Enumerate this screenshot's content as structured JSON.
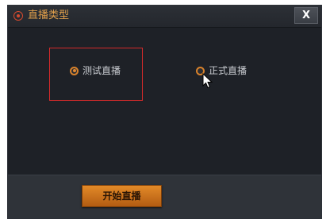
{
  "window": {
    "title": "直播类型",
    "close_label": "X",
    "accent_color": "#e2a04b",
    "icon": "record-icon"
  },
  "options": [
    {
      "label": "测试直播",
      "selected": true
    },
    {
      "label": "正式直播",
      "selected": false
    }
  ],
  "footer": {
    "start_button_label": "开始直播"
  }
}
